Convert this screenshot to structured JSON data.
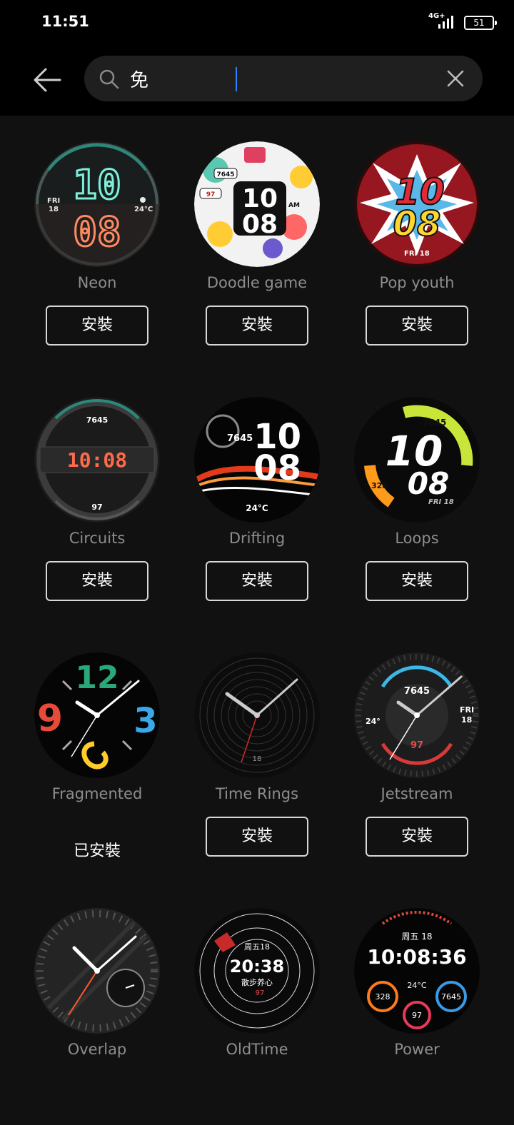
{
  "status_bar": {
    "time": "11:51",
    "network": "4G+",
    "battery": "51"
  },
  "search": {
    "query": "免",
    "placeholder": ""
  },
  "watch_faces": [
    {
      "name": "Neon",
      "action": "安裝",
      "installed": false,
      "face": {
        "top": "10",
        "bottom": "08",
        "date_day": "FRI",
        "date_num": "18",
        "temp": "24°C"
      }
    },
    {
      "name": "Doodle game",
      "action": "安裝",
      "installed": false,
      "face": {
        "top": "10",
        "bottom": "08",
        "ampm": "AM",
        "steps": "7645",
        "heart": "97"
      }
    },
    {
      "name": "Pop youth",
      "action": "安裝",
      "installed": false,
      "face": {
        "top": "10",
        "bottom": "08",
        "date": "FRI 18"
      }
    },
    {
      "name": "Circuits",
      "action": "安裝",
      "installed": false,
      "face": {
        "time": "10:08",
        "steps": "7645",
        "heart": "97"
      }
    },
    {
      "name": "Drifting",
      "action": "安裝",
      "installed": false,
      "face": {
        "top": "10",
        "bottom": "08",
        "steps": "7645",
        "temp": "24°C"
      }
    },
    {
      "name": "Loops",
      "action": "安裝",
      "installed": false,
      "face": {
        "top": "10",
        "bottom": "08",
        "steps": "7645",
        "cal": "328",
        "date": "FRI 18"
      }
    },
    {
      "name": "Fragmented",
      "action": "已安裝",
      "installed": true,
      "face": {
        "hour12": "12",
        "hour9": "9",
        "hour3": "3"
      }
    },
    {
      "name": "Time Rings",
      "action": "安裝",
      "installed": false,
      "face": {
        "date": "18"
      }
    },
    {
      "name": "Jetstream",
      "action": "安裝",
      "installed": false,
      "face": {
        "steps": "7645",
        "heart": "97",
        "temp": "24°",
        "date_day": "FRI",
        "date_num": "18"
      }
    },
    {
      "name": "Overlap",
      "installed": false,
      "face": {}
    },
    {
      "name": "OldTime",
      "installed": false,
      "face": {
        "date": "周五18",
        "time": "20:38",
        "label": "散步养心",
        "heart": "97"
      }
    },
    {
      "name": "Power",
      "installed": false,
      "face": {
        "date": "周五 18",
        "time": "10:08:36",
        "temp": "24°C",
        "cal": "328",
        "steps": "7645",
        "heart": "97"
      }
    }
  ],
  "colors": {
    "background": "#111111",
    "header": "#000000",
    "search_bg": "#1f1f1f",
    "caret": "#2a82ff",
    "label": "#8d8d8d"
  }
}
